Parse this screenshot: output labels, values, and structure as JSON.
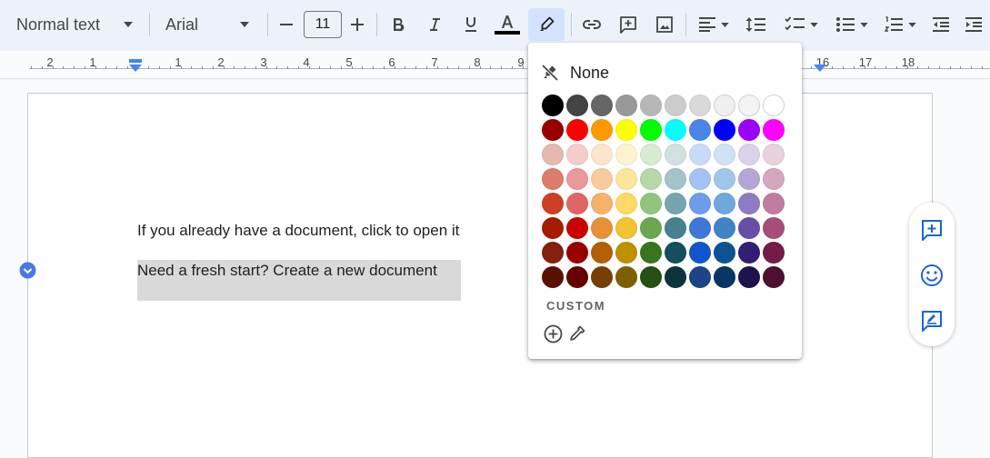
{
  "toolbar": {
    "style_select": {
      "value": "Normal text"
    },
    "font_select": {
      "value": "Arial"
    },
    "font_size": {
      "value": "11"
    },
    "text_color_underline": "#000000"
  },
  "ruler": {
    "numbers": [
      "2",
      "1",
      "1",
      "2",
      "3",
      "4",
      "5",
      "6",
      "7",
      "8",
      "9",
      "16",
      "17",
      "18"
    ]
  },
  "document": {
    "paragraphs": [
      {
        "text": "If you already have a document, click to open it"
      },
      {
        "text": "Need a fresh start? Create a new document",
        "highlighted": true,
        "highlight_color": "#d9d9d9"
      }
    ]
  },
  "highlight_palette": {
    "none_label": "None",
    "custom_label": "CUSTOM",
    "colors": [
      [
        "#000000",
        "#434343",
        "#666666",
        "#999999",
        "#b7b7b7",
        "#cccccc",
        "#d9d9d9",
        "#efefef",
        "#f3f3f3",
        "#ffffff"
      ],
      [
        "#980000",
        "#ff0000",
        "#ff9900",
        "#ffff00",
        "#00ff00",
        "#00ffff",
        "#4a86e8",
        "#0000ff",
        "#9900ff",
        "#ff00ff"
      ],
      [
        "#e6b8af",
        "#f4cccc",
        "#fce5cd",
        "#fff2cc",
        "#d9ead3",
        "#d0e0e3",
        "#c9daf8",
        "#cfe2f3",
        "#d9d2e9",
        "#ead1dc"
      ],
      [
        "#dd7e6b",
        "#ea9999",
        "#f9cb9c",
        "#ffe599",
        "#b6d7a8",
        "#a2c4c9",
        "#a4c2f4",
        "#9fc5e8",
        "#b4a7d6",
        "#d5a6bd"
      ],
      [
        "#cc4125",
        "#e06666",
        "#f6b26b",
        "#ffd966",
        "#93c47d",
        "#76a5af",
        "#6d9eeb",
        "#6fa8dc",
        "#8e7cc3",
        "#c27ba0"
      ],
      [
        "#a61c00",
        "#cc0000",
        "#e69138",
        "#f1c232",
        "#6aa84f",
        "#45818e",
        "#3c78d8",
        "#3d85c6",
        "#674ea7",
        "#a64d79"
      ],
      [
        "#85200c",
        "#990000",
        "#b45f06",
        "#bf9000",
        "#38761d",
        "#134f5c",
        "#1155cc",
        "#0b5394",
        "#351c75",
        "#741b47"
      ],
      [
        "#5b0f00",
        "#660000",
        "#783f04",
        "#7f6000",
        "#274e13",
        "#0c343d",
        "#1c4587",
        "#073763",
        "#20124d",
        "#4c1130"
      ]
    ]
  }
}
